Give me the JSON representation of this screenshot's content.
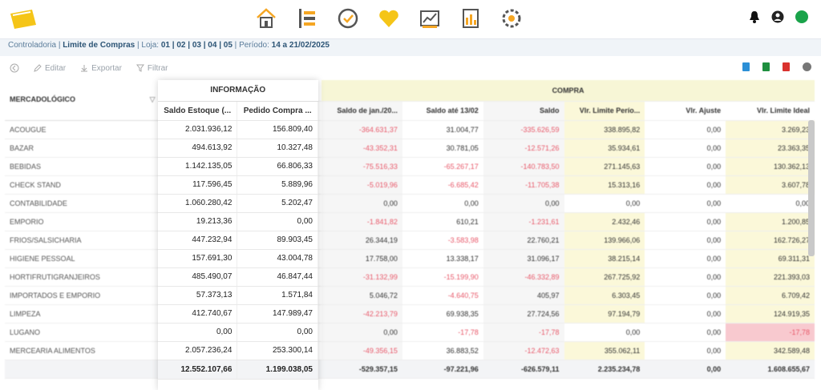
{
  "breadcrumb": {
    "section": "Controladoria",
    "page": "Limite de Compras",
    "loja_label": "Loja:",
    "lojas": "01 | 02 | 03 | 04 | 05",
    "periodo_label": "Período:",
    "periodo": "14 a 21/02/2025"
  },
  "toolbar": {
    "edit": "Editar",
    "export": "Exportar",
    "filter": "Filtrar"
  },
  "colors": {
    "accent_yellow": "#f5c518",
    "negative": "#e8596a",
    "highlight": "#fbf8d9",
    "highlight_red": "#f8c9cf",
    "status_green": "#1aa34a"
  },
  "table": {
    "info_title": "INFORMAÇÃO",
    "compra_title": "COMPRA",
    "headers": {
      "merc": "MERCADOLÓGICO",
      "saldo_estoque": "Saldo Estoque (...",
      "pedido_compra": "Pedido Compra ...",
      "saldo_jan": "Saldo de jan./20...",
      "saldo_ate": "Saldo até 13/02",
      "saldo": "Saldo",
      "vl_limite_periodo": "Vlr. Limite Perío...",
      "vl_ajuste": "Vlr. Ajuste",
      "vl_limite_ideal": "Vlr. Limite Ideal"
    },
    "rows": [
      {
        "merc": "ACOUGUE",
        "estoque": "2.031.936,12",
        "pedido": "156.809,40",
        "jan": "-364.631,37",
        "ate": "31.004,77",
        "saldo": "-335.626,59",
        "limite": "338.895,82",
        "ajuste": "0,00",
        "ideal": "3.269,23"
      },
      {
        "merc": "BAZAR",
        "estoque": "494.613,92",
        "pedido": "10.327,48",
        "jan": "-43.352,31",
        "ate": "30.781,05",
        "saldo": "-12.571,26",
        "limite": "35.934,61",
        "ajuste": "0,00",
        "ideal": "23.363,35"
      },
      {
        "merc": "BEBIDAS",
        "estoque": "1.142.135,05",
        "pedido": "66.806,33",
        "jan": "-75.516,33",
        "ate": "-65.267,17",
        "saldo": "-140.783,50",
        "limite": "271.145,63",
        "ajuste": "0,00",
        "ideal": "130.362,13"
      },
      {
        "merc": "CHECK STAND",
        "estoque": "117.596,45",
        "pedido": "5.889,96",
        "jan": "-5.019,96",
        "ate": "-6.685,42",
        "saldo": "-11.705,38",
        "limite": "15.313,16",
        "ajuste": "0,00",
        "ideal": "3.607,78"
      },
      {
        "merc": "CONTABILIDADE",
        "estoque": "1.060.280,42",
        "pedido": "5.202,47",
        "jan": "0,00",
        "ate": "0,00",
        "saldo": "0,00",
        "limite": "0,00",
        "ajuste": "0,00",
        "ideal": "0,00"
      },
      {
        "merc": "EMPORIO",
        "estoque": "19.213,36",
        "pedido": "0,00",
        "jan": "-1.841,82",
        "ate": "610,21",
        "saldo": "-1.231,61",
        "limite": "2.432,46",
        "ajuste": "0,00",
        "ideal": "1.200,85"
      },
      {
        "merc": "FRIOS/SALSICHARIA",
        "estoque": "447.232,94",
        "pedido": "89.903,45",
        "jan": "26.344,19",
        "ate": "-3.583,98",
        "saldo": "22.760,21",
        "limite": "139.966,06",
        "ajuste": "0,00",
        "ideal": "162.726,27"
      },
      {
        "merc": "HIGIENE PESSOAL",
        "estoque": "157.691,30",
        "pedido": "43.004,78",
        "jan": "17.758,00",
        "ate": "13.338,17",
        "saldo": "31.096,17",
        "limite": "38.215,14",
        "ajuste": "0,00",
        "ideal": "69.311,31"
      },
      {
        "merc": "HORTIFRUTIGRANJEIROS",
        "estoque": "485.490,07",
        "pedido": "46.847,44",
        "jan": "-31.132,99",
        "ate": "-15.199,90",
        "saldo": "-46.332,89",
        "limite": "267.725,92",
        "ajuste": "0,00",
        "ideal": "221.393,03"
      },
      {
        "merc": "IMPORTADOS E EMPORIO",
        "estoque": "57.373,13",
        "pedido": "1.571,84",
        "jan": "5.046,72",
        "ate": "-4.640,75",
        "saldo": "405,97",
        "limite": "6.303,45",
        "ajuste": "0,00",
        "ideal": "6.709,42"
      },
      {
        "merc": "LIMPEZA",
        "estoque": "412.740,67",
        "pedido": "147.989,47",
        "jan": "-42.213,79",
        "ate": "69.938,35",
        "saldo": "27.724,56",
        "limite": "97.194,79",
        "ajuste": "0,00",
        "ideal": "124.919,35"
      },
      {
        "merc": "LUGANO",
        "estoque": "0,00",
        "pedido": "0,00",
        "jan": "0,00",
        "ate": "-17,78",
        "saldo": "-17,78",
        "limite": "0,00",
        "ajuste": "0,00",
        "ideal": "-17,78"
      },
      {
        "merc": "MERCEARIA ALIMENTOS",
        "estoque": "2.057.236,24",
        "pedido": "253.300,14",
        "jan": "-49.356,15",
        "ate": "36.883,52",
        "saldo": "-12.472,63",
        "limite": "355.062,11",
        "ajuste": "0,00",
        "ideal": "342.589,48"
      }
    ],
    "totals": {
      "estoque": "12.552.107,66",
      "pedido": "1.199.038,05",
      "jan": "-529.357,15",
      "ate": "-97.221,96",
      "saldo": "-626.579,11",
      "limite": "2.235.234,78",
      "ajuste": "0,00",
      "ideal": "1.608.655,67"
    }
  }
}
